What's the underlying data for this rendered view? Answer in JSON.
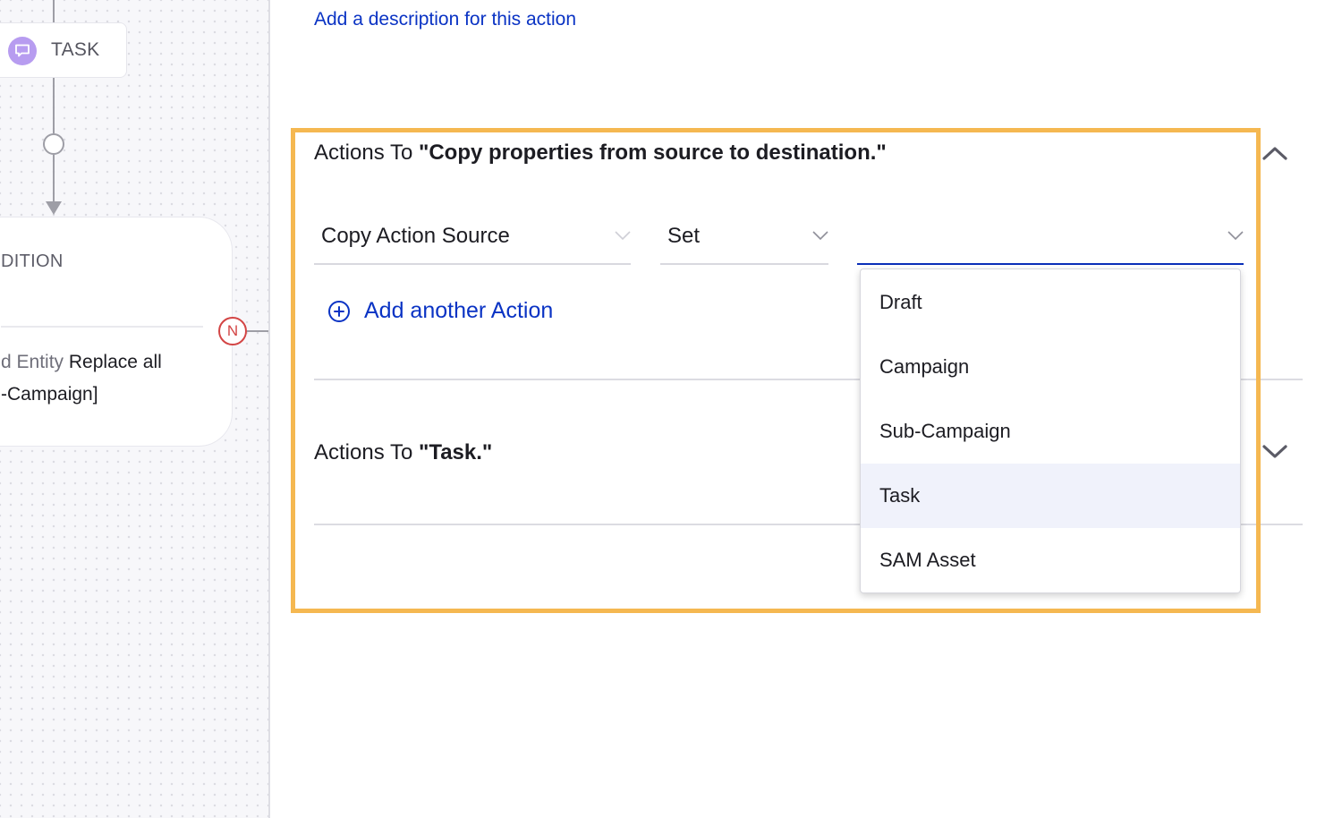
{
  "canvas": {
    "task_node": {
      "label": "TASK",
      "icon": "chat-bubble-icon",
      "icon_color": "#b79cf0"
    },
    "condition_node": {
      "title_fragment": "DITION",
      "body_line1_muted": "d Entity",
      "body_line1_value": " Replace all",
      "body_line2": "-Campaign]"
    },
    "branch_badge": {
      "label": "N",
      "color": "#d34545"
    }
  },
  "panel": {
    "description_link": "Add a description for this action",
    "sections": [
      {
        "prefix": "Actions To ",
        "name": "\"Copy properties from source to destination.\"",
        "expanded": true,
        "fields": [
          {
            "value": "Copy Action Source"
          },
          {
            "value": "Set"
          },
          {
            "value": ""
          }
        ],
        "add_action_label": "Add another Action"
      },
      {
        "prefix": "Actions To ",
        "name": "\"Task.\"",
        "expanded": false
      }
    ],
    "dropdown": {
      "options": [
        "Draft",
        "Campaign",
        "Sub-Campaign",
        "Task",
        "SAM Asset"
      ],
      "highlighted_index": 3
    },
    "colors": {
      "link": "#0a33c4",
      "highlight_border": "#f5b851",
      "active_underline": "#0a2fb8"
    }
  }
}
